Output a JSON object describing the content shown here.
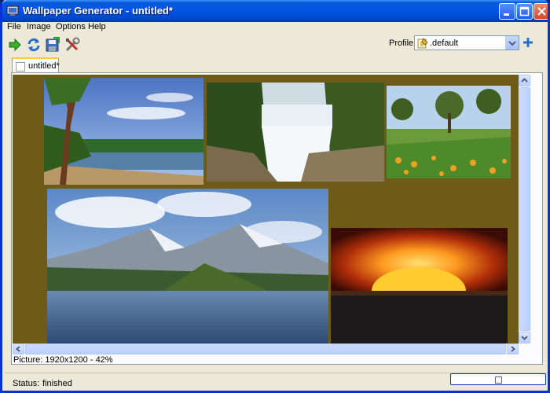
{
  "window": {
    "title": "Wallpaper Generator - untitled*"
  },
  "menu": [
    {
      "label": "File"
    },
    {
      "label": "Image"
    },
    {
      "label": "Options"
    },
    {
      "label": "Help"
    }
  ],
  "toolbar": {
    "tools": [
      {
        "icon": "arrow-right-icon"
      },
      {
        "icon": "refresh-icon"
      },
      {
        "icon": "save-icon"
      },
      {
        "icon": "tools-icon"
      }
    ],
    "profile_label": "Profile:",
    "profile_value": ".default"
  },
  "tab": {
    "label": "untitled*"
  },
  "canvas": {
    "background": "#6e5b18",
    "photos": [
      {
        "name": "beach-tree"
      },
      {
        "name": "waterfall"
      },
      {
        "name": "flower-meadow"
      },
      {
        "name": "mountain-lake"
      },
      {
        "name": "sunset-sea"
      }
    ]
  },
  "picture_info": "Picture: 1920x1200 - 42%",
  "status": {
    "label": "Status:",
    "value": "finished"
  }
}
